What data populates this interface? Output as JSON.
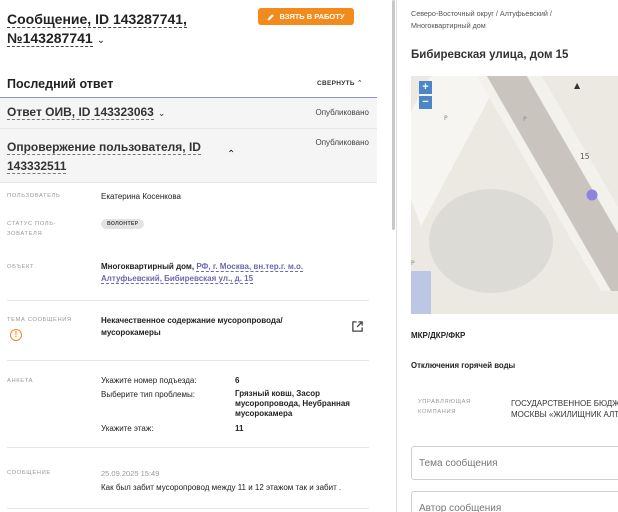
{
  "message": {
    "title_line1": "Сообщение, ID 143287741,",
    "title_line2": "№143287741",
    "take_button": "ВЗЯТЬ В РАБОТУ"
  },
  "last_answer": {
    "heading": "Последний ответ",
    "collapse": "СВЕРНУТЬ"
  },
  "answer": {
    "title": "Ответ ОИВ, ID 143323063",
    "status": "Опубликовано"
  },
  "refutation": {
    "title_line1": "Опровержение пользователя, ID",
    "title_line2": "143332511",
    "status": "Опубликовано"
  },
  "fields": {
    "user_label": "ПОЛЬЗОВАТЕЛЬ",
    "user_value": "Екатерина Косенкова",
    "status_label_1": "СТАТУС ПОЛЬ-",
    "status_label_2": "ЗОВАТЕЛЯ",
    "status_value": "ВОЛОНТЕР",
    "object_label": "ОБЪЕКТ",
    "object_type": "Многоквартирный дом,",
    "object_link_1": "РФ, г. Москва, вн.тер.г. м.о.",
    "object_link_2": "Алтуфьевский, Бибиревская ул., д. 15",
    "topic_label": "ТЕМА СООБЩЕНИЯ",
    "topic_value_1": "Некачественное содержание мусоропровода/",
    "topic_value_2": "мусорокамеры",
    "survey_label": "АНКЕТА",
    "survey": [
      {
        "q": "Укажите номер подъезда:",
        "a": [
          "6"
        ]
      },
      {
        "q": "Выберите тип проблемы:",
        "a": [
          "Грязный ковш, Засор",
          "мусоропровода, Неубранная",
          "мусорокамера"
        ]
      },
      {
        "q": "Укажите этаж:",
        "a": [
          "11"
        ]
      }
    ],
    "message_label": "СООБЩЕНИЕ",
    "message_date": "25.09.2025 15:49",
    "message_text": "Как был забит мусоропровод между 11 и 12 этажом так и забит ."
  },
  "right": {
    "crumb_1": "Северо-Восточный округ / Алтуфьевский /",
    "crumb_2": "Многоквартирный дом",
    "address": "Бибиревская улица, дом 15",
    "map": {
      "zoom_in": "+",
      "zoom_out": "−",
      "house_number": "15",
      "marker_color": "#8e84dd"
    },
    "mkr": "МКР/ДКР/ФКР",
    "hot_water": "Отключения горячей воды",
    "uk_label_1": "УПРАВЛЯЮЩАЯ",
    "uk_label_2": "КОМПАНИЯ",
    "uk_value_1": "ГОСУДАРСТВЕННОЕ БЮДЖ",
    "uk_value_2": "МОСКВЫ «ЖИЛИЩНИК АЛТ",
    "topic_input_placeholder": "Тема сообщения",
    "author_input_placeholder": "Автор сообщения"
  },
  "colors": {
    "accent_orange": "#f28b1c",
    "link_purple": "#6d67b5",
    "zoom_blue": "#4a86c8"
  }
}
